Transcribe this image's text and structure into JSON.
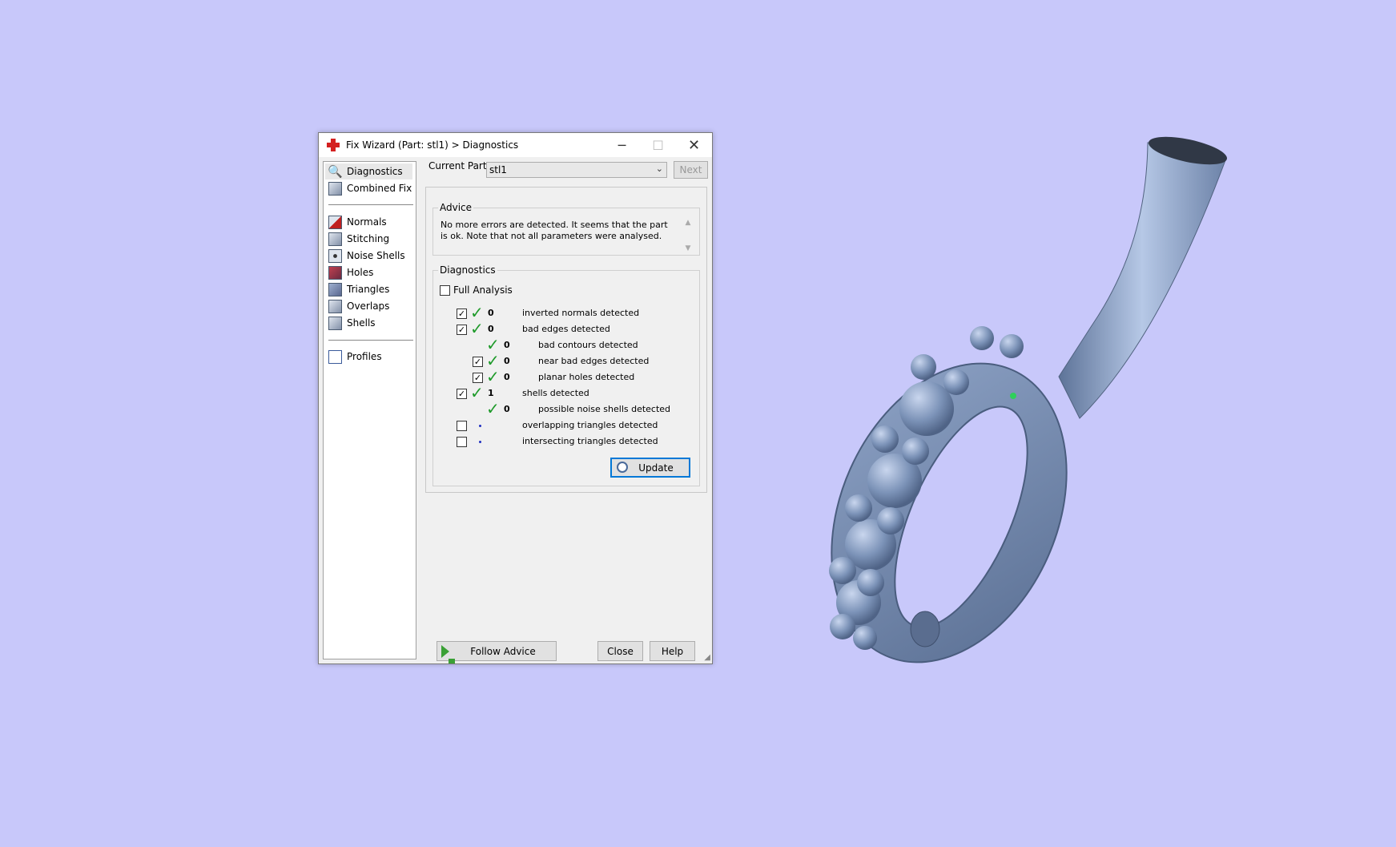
{
  "window": {
    "title": "Fix Wizard (Part: stl1) > Diagnostics"
  },
  "sidebar": {
    "items": [
      {
        "label": "Diagnostics",
        "selected": true
      },
      {
        "label": "Combined Fix"
      },
      {
        "label": "Normals"
      },
      {
        "label": "Stitching"
      },
      {
        "label": "Noise Shells"
      },
      {
        "label": "Holes"
      },
      {
        "label": "Triangles"
      },
      {
        "label": "Overlaps"
      },
      {
        "label": "Shells"
      },
      {
        "label": "Profiles"
      }
    ]
  },
  "header": {
    "current_part_label": "Current Part:",
    "current_part_value": "stl1",
    "next_label": "Next"
  },
  "advice": {
    "title": "Advice",
    "text": "No more errors are detected. It seems that the part is ok. Note that not all parameters were analysed."
  },
  "diagnostics": {
    "title": "Diagnostics",
    "full_analysis_label": "Full Analysis",
    "full_analysis_checked": false,
    "rows": [
      {
        "checked": true,
        "count": "0",
        "label": "inverted normals detected"
      },
      {
        "checked": true,
        "count": "0",
        "label": "bad edges detected"
      },
      {
        "count": "0",
        "label": "bad contours detected"
      },
      {
        "checked": true,
        "count": "0",
        "label": "near bad edges detected"
      },
      {
        "checked": true,
        "count": "0",
        "label": "planar holes detected"
      },
      {
        "checked": true,
        "count": "1",
        "label": "shells detected"
      },
      {
        "count": "0",
        "label": "possible noise shells detected"
      },
      {
        "checked": false,
        "label": "overlapping triangles detected"
      },
      {
        "checked": false,
        "label": "intersecting triangles detected"
      }
    ],
    "update_label": "Update"
  },
  "footer": {
    "follow_advice_label": "Follow Advice",
    "close_label": "Close",
    "help_label": "Help"
  },
  "colors": {
    "background": "#c8c8fa",
    "model": "#6f86aa",
    "check": "#1e9a2a",
    "focus": "#0078d7"
  }
}
